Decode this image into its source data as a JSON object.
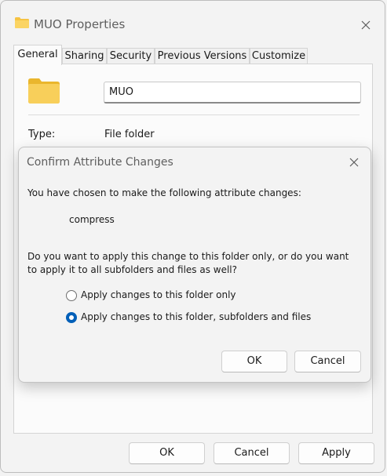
{
  "window": {
    "title": "MUO Properties",
    "tabs": [
      {
        "label": "General",
        "active": true
      },
      {
        "label": "Sharing",
        "active": false
      },
      {
        "label": "Security",
        "active": false
      },
      {
        "label": "Previous Versions",
        "active": false
      },
      {
        "label": "Customize",
        "active": false
      }
    ],
    "general": {
      "folder_name": "MUO",
      "type_label": "Type:",
      "type_value": "File folder"
    },
    "buttons": {
      "ok": "OK",
      "cancel": "Cancel",
      "apply": "Apply"
    }
  },
  "dialog": {
    "title": "Confirm Attribute Changes",
    "intro": "You have chosen to make the following attribute changes:",
    "attribute_change": "compress",
    "question": "Do you want to apply this change to this folder only, or do you want to apply it to all subfolders and files as well?",
    "options": [
      {
        "label": "Apply changes to this folder only",
        "selected": false
      },
      {
        "label": "Apply changes to this folder, subfolders and files",
        "selected": true
      }
    ],
    "buttons": {
      "ok": "OK",
      "cancel": "Cancel"
    }
  },
  "colors": {
    "accent": "#005fb8",
    "folder": "#f6c342"
  },
  "icons": {
    "folder": "folder-icon",
    "close": "close-icon"
  }
}
